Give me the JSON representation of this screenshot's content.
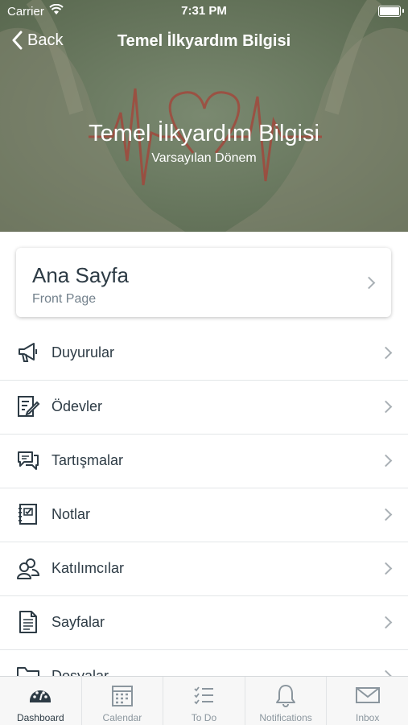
{
  "status_bar": {
    "carrier": "Carrier",
    "time": "7:31 PM"
  },
  "nav": {
    "back_label": "Back",
    "title": "Temel İlkyardım Bilgisi"
  },
  "hero": {
    "title": "Temel İlkyardım Bilgisi",
    "subtitle": "Varsayılan Dönem",
    "background_color": "#6b7a5f"
  },
  "front_page": {
    "title": "Ana Sayfa",
    "subtitle": "Front Page"
  },
  "menu": [
    {
      "label": "Duyurular",
      "icon": "megaphone-icon"
    },
    {
      "label": "Ödevler",
      "icon": "assignment-icon"
    },
    {
      "label": "Tartışmalar",
      "icon": "discussion-icon"
    },
    {
      "label": "Notlar",
      "icon": "gradebook-icon"
    },
    {
      "label": "Katılımcılar",
      "icon": "people-icon"
    },
    {
      "label": "Sayfalar",
      "icon": "document-icon"
    },
    {
      "label": "Dosyalar",
      "icon": "folder-icon"
    }
  ],
  "tabs": [
    {
      "label": "Dashboard",
      "icon": "dashboard-icon",
      "active": true
    },
    {
      "label": "Calendar",
      "icon": "calendar-icon",
      "active": false
    },
    {
      "label": "To Do",
      "icon": "todo-icon",
      "active": false
    },
    {
      "label": "Notifications",
      "icon": "bell-icon",
      "active": false
    },
    {
      "label": "Inbox",
      "icon": "envelope-icon",
      "active": false
    }
  ],
  "colors": {
    "text": "#2d3b45",
    "muted": "#8b969e",
    "heartbeat": "#a4453a"
  }
}
